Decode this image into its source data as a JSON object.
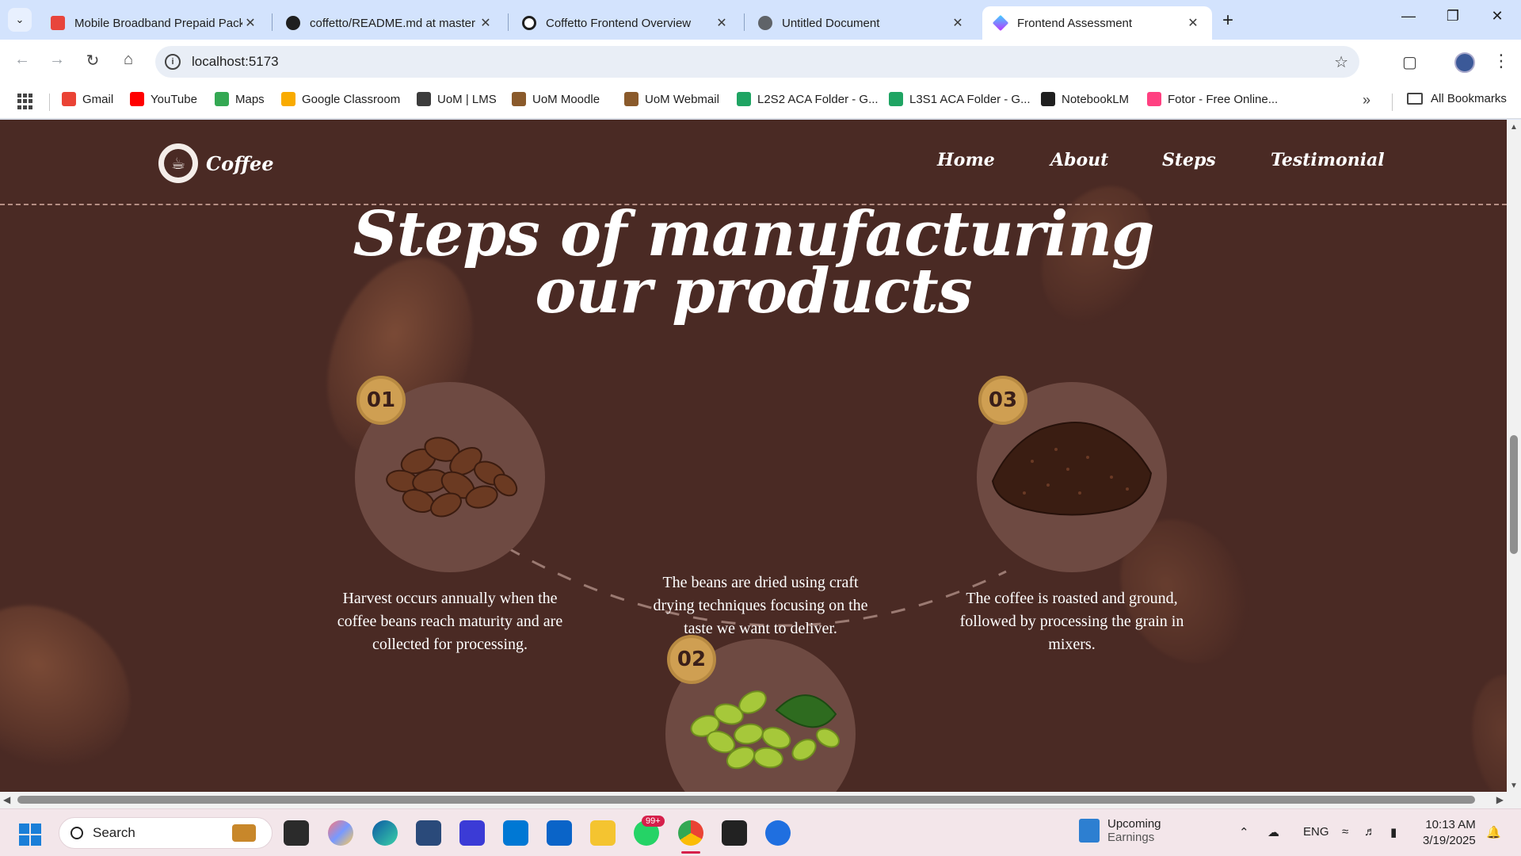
{
  "browser": {
    "tabs": [
      {
        "title": "Mobile Broadband Prepaid Pack",
        "color": "#e8453c"
      },
      {
        "title": "coffetto/README.md at master",
        "color": "#1f1f1f"
      },
      {
        "title": "Coffetto Frontend Overview",
        "color": "#1f1f1f"
      },
      {
        "title": "Untitled Document",
        "color": "#5f6368"
      },
      {
        "title": "Frontend Assessment",
        "color": "#9b59f5"
      }
    ],
    "new_tab": "+",
    "url": "localhost:5173",
    "bookmarks": [
      {
        "label": "Gmail",
        "color": "#ea4335"
      },
      {
        "label": "YouTube",
        "color": "#ff0000"
      },
      {
        "label": "Maps",
        "color": "#34a853"
      },
      {
        "label": "Google Classroom",
        "color": "#f9ab00"
      },
      {
        "label": "UoM | LMS",
        "color": "#3c3c3c"
      },
      {
        "label": "UoM  Moodle",
        "color": "#8a5a2b"
      },
      {
        "label": "UoM Webmail",
        "color": "#8a5a2b"
      },
      {
        "label": "L2S2 ACA Folder - G...",
        "color": "#1fa463"
      },
      {
        "label": "L3S1 ACA Folder - G...",
        "color": "#1fa463"
      },
      {
        "label": "NotebookLM",
        "color": "#1f1f1f"
      },
      {
        "label": "Fotor - Free Online...",
        "color": "#ff4081"
      }
    ],
    "all_bookmarks": "All Bookmarks"
  },
  "site": {
    "logo_text": "Coffee",
    "nav": [
      "Home",
      "About",
      "Steps",
      "Testimonial"
    ],
    "heading_line1": "Steps of manufacturing",
    "heading_line2": "our products",
    "steps": [
      {
        "number": "01",
        "text": "Harvest occurs annually when the coffee beans reach maturity and are collected for processing.",
        "image": "roasted-coffee-beans"
      },
      {
        "number": "02",
        "text": "The beans are dried using craft drying techniques focusing on the taste we want to deliver.",
        "image": "green-coffee-beans"
      },
      {
        "number": "03",
        "text": "The coffee is roasted and ground, followed by processing the grain in mixers.",
        "image": "ground-coffee"
      }
    ],
    "colors": {
      "background": "#4a2a24",
      "badge": "#cf9f52",
      "circle": "#6e4a42"
    }
  },
  "taskbar": {
    "search_placeholder": "Search",
    "badge": "99+",
    "weather_title": "Upcoming",
    "weather_sub": "Earnings",
    "language": "ENG",
    "time": "10:13 AM",
    "date": "3/19/2025"
  }
}
